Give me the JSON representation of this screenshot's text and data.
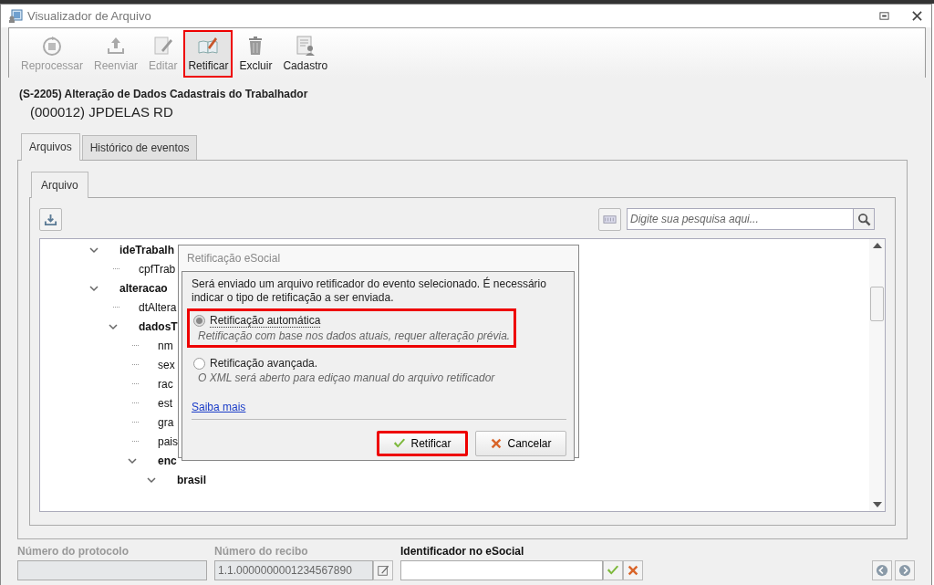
{
  "window": {
    "title": "Visualizador de Arquivo"
  },
  "toolbar": [
    {
      "label": "Reprocessar",
      "kind": "reprocess",
      "disabled": true,
      "highlighted": false
    },
    {
      "label": "Reenviar",
      "kind": "resend",
      "disabled": true,
      "highlighted": false
    },
    {
      "label": "Editar",
      "kind": "edit",
      "disabled": true,
      "highlighted": false
    },
    {
      "label": "Retificar",
      "kind": "rectify",
      "disabled": false,
      "highlighted": true
    },
    {
      "label": "Excluir",
      "kind": "delete",
      "disabled": false,
      "highlighted": false
    },
    {
      "label": "Cadastro",
      "kind": "record",
      "disabled": false,
      "highlighted": false
    }
  ],
  "event": {
    "title": "(S-2205) Alteração de Dados Cadastrais do Trabalhador",
    "employee": "(000012) JPDELAS RD"
  },
  "tabs": [
    {
      "label": "Arquivos",
      "selected": true
    },
    {
      "label": "Histórico de eventos",
      "selected": false
    }
  ],
  "inner_tabs": [
    {
      "label": "Arquivo",
      "selected": true
    }
  ],
  "search": {
    "placeholder": "Digite sua pesquisa aqui..."
  },
  "tree": [
    {
      "label": "ideTrabalh",
      "expanded": true,
      "children": [
        {
          "label": "cpfTrab"
        }
      ]
    },
    {
      "label": "alteracao",
      "expanded": true,
      "children": [
        {
          "label": "dtAltera"
        },
        {
          "label": "dadosT",
          "expanded": true,
          "children": [
            {
              "label": "nm"
            },
            {
              "label": "sex"
            },
            {
              "label": "rac"
            },
            {
              "label": "est"
            },
            {
              "label": "gra"
            },
            {
              "label": "pais"
            },
            {
              "label": "enc",
              "expanded": true,
              "children": [
                {
                  "label": "brasil",
                  "expanded": true
                }
              ]
            }
          ]
        }
      ]
    }
  ],
  "dialog": {
    "title": "Retificação eSocial",
    "message": "Será enviado um arquivo retificador do evento selecionado. É necessário indicar o tipo de retificação a ser enviada.",
    "options": [
      {
        "label": "Retificação automática",
        "description": "Retificação com base nos dados atuais, requer alteração prévia.",
        "selected": true,
        "highlighted": true
      },
      {
        "label": "Retificação avançada.",
        "description": "O XML será aberto para ediçao manual do arquivo retificador",
        "selected": false,
        "highlighted": false
      }
    ],
    "link": "Saiba mais",
    "buttons": [
      {
        "label": "Retificar",
        "kind": "confirm",
        "highlighted": true
      },
      {
        "label": "Cancelar",
        "kind": "cancel",
        "highlighted": false
      }
    ]
  },
  "footer": {
    "fields": [
      {
        "label": "Número do protocolo",
        "kind": "protocol",
        "disabled": true
      },
      {
        "label": "Número do recibo",
        "kind": "receipt",
        "disabled": true,
        "value": "1.1.0000000001234567890"
      },
      {
        "label": "Identificador no eSocial",
        "kind": "identifier",
        "disabled": false
      }
    ]
  }
}
